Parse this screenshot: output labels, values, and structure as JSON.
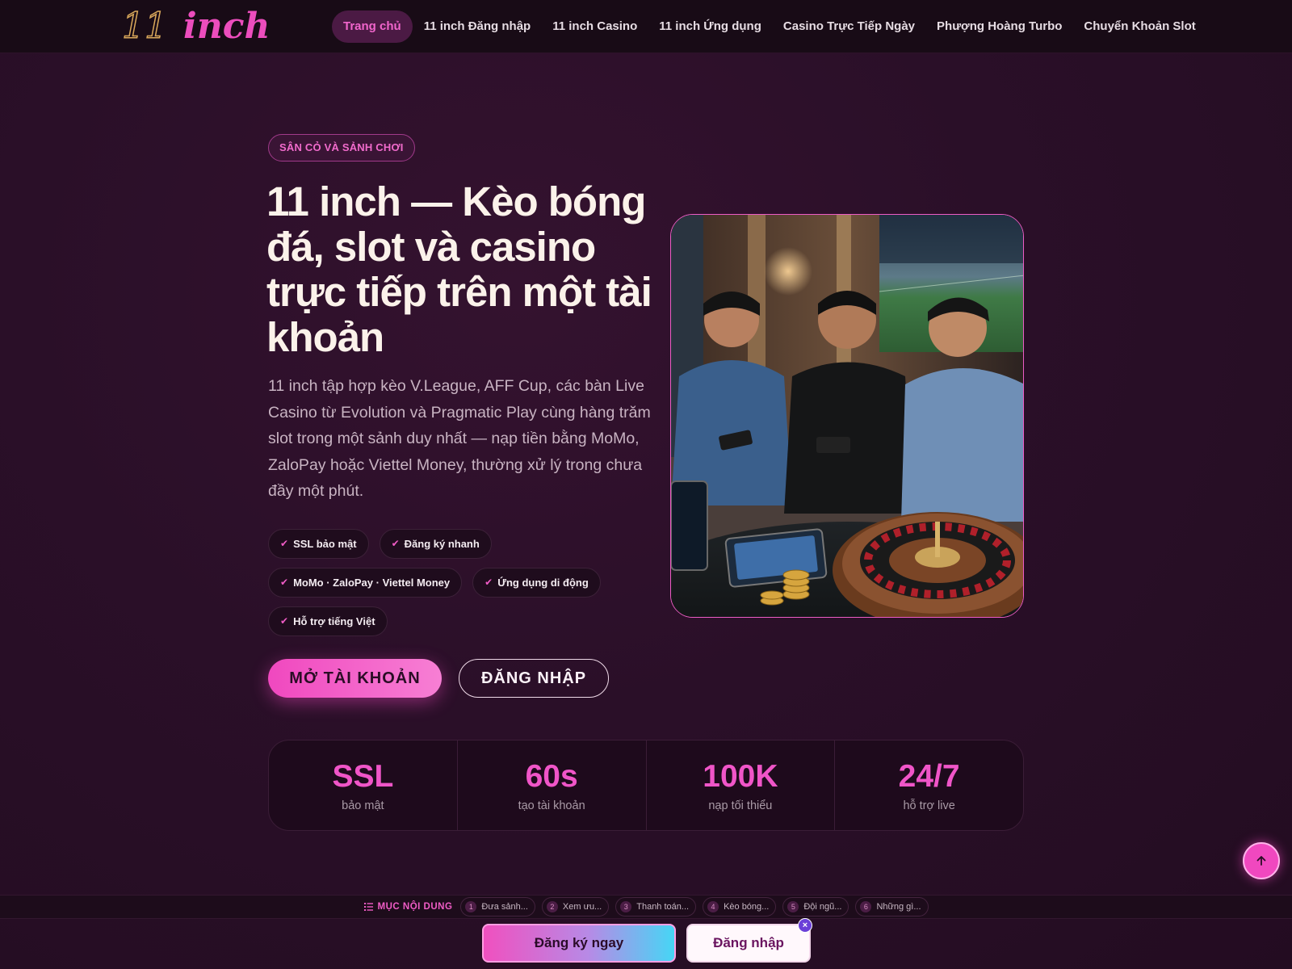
{
  "brand": {
    "logo_num": "11",
    "logo_word": "inch"
  },
  "nav": [
    {
      "label": "Trang chủ",
      "active": true
    },
    {
      "label": "11 inch Đăng nhập"
    },
    {
      "label": "11 inch Casino"
    },
    {
      "label": "11 inch Ứng dụng"
    },
    {
      "label": "Casino Trực Tiếp Ngày"
    },
    {
      "label": "Phượng Hoàng Turbo"
    },
    {
      "label": "Chuyển Khoản Slot"
    }
  ],
  "hero": {
    "eyebrow": "SÂN CỎ VÀ SẢNH CHƠI",
    "title": "11 inch — Kèo bóng đá, slot và casino trực tiếp trên một tài khoản",
    "description": "11 inch tập hợp kèo V.League, AFF Cup, các bàn Live Casino từ Evolution và Pragmatic Play cùng hàng trăm slot trong một sảnh duy nhất — nạp tiền bằng MoMo, ZaloPay hoặc Viettel Money, thường xử lý trong chưa đầy một phút.",
    "chips": [
      "SSL bảo mật",
      "Đăng ký nhanh",
      "MoMo · ZaloPay · Viettel Money",
      "Ứng dụng di động",
      "Hỗ trợ tiếng Việt"
    ],
    "primary_button": "MỞ TÀI KHOẢN",
    "secondary_button": "ĐĂNG NHẬP"
  },
  "stats": [
    {
      "value": "SSL",
      "label": "bảo mật"
    },
    {
      "value": "60s",
      "label": "tạo tài khoản"
    },
    {
      "value": "100K",
      "label": "nạp tối thiểu"
    },
    {
      "value": "24/7",
      "label": "hỗ trợ live"
    }
  ],
  "toc": {
    "label": "MỤC NỘI DUNG",
    "items": [
      {
        "n": "1",
        "label": "Đưa sảnh..."
      },
      {
        "n": "2",
        "label": "Xem ưu..."
      },
      {
        "n": "3",
        "label": "Thanh toán..."
      },
      {
        "n": "4",
        "label": "Kèo bóng..."
      },
      {
        "n": "5",
        "label": "Đội ngũ..."
      },
      {
        "n": "6",
        "label": "Những gì..."
      }
    ]
  },
  "sticky_cta": {
    "register": "Đăng ký ngay",
    "login": "Đăng nhập",
    "close": "×"
  },
  "icons": {
    "back_to_top": "arrow-up-icon",
    "check": "check-icon",
    "toc": "list-icon"
  },
  "colors": {
    "accent": "#f048bf",
    "background": "#2a0f28",
    "logo_outline": "#d9a85b"
  }
}
